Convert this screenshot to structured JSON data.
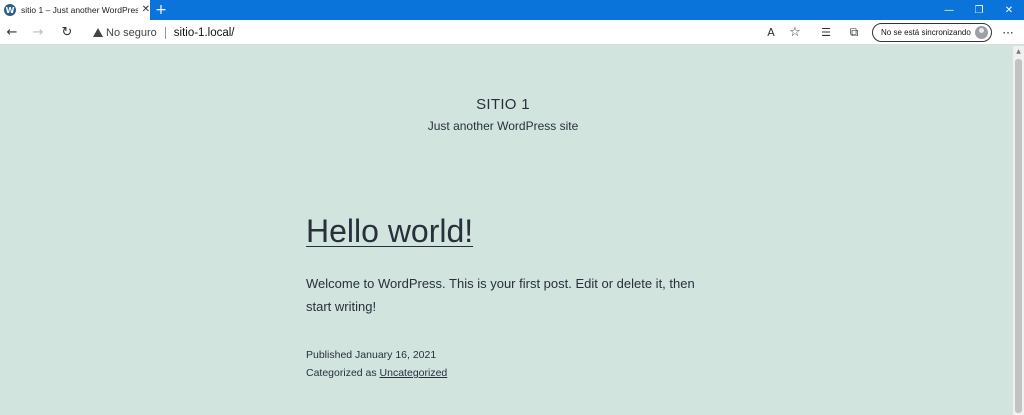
{
  "browser": {
    "tab": {
      "title": "sitio 1 – Just another WordPress site",
      "icon": "wordpress-icon",
      "close_glyph": "✕"
    },
    "new_tab_glyph": "+",
    "window_controls": {
      "minimize": "—",
      "restore": "❐",
      "close": "✕"
    },
    "nav": {
      "back": "←",
      "forward": "→",
      "reload": "↻"
    },
    "address": {
      "security_label": "No seguro",
      "url": "sitio-1.local/"
    },
    "toolbar_icons": {
      "read_aloud": "A",
      "favorite": "☆",
      "favorites_list": "☰",
      "collections": "⧉"
    },
    "sync_label": "No se está sincronizando",
    "more_glyph": "···"
  },
  "site": {
    "title": "SITIO 1",
    "description": "Just another WordPress site"
  },
  "post": {
    "title": "Hello world!",
    "body": "Welcome to WordPress. This is your first post. Edit or delete it, then start writing!",
    "published_prefix": "Published ",
    "published_date": "January 16, 2021",
    "categorized_prefix": "Categorized as ",
    "category": "Uncategorized"
  },
  "colors": {
    "titlebar": "#0a74da",
    "page_background": "#d1e4dd",
    "text": "#28303d"
  }
}
